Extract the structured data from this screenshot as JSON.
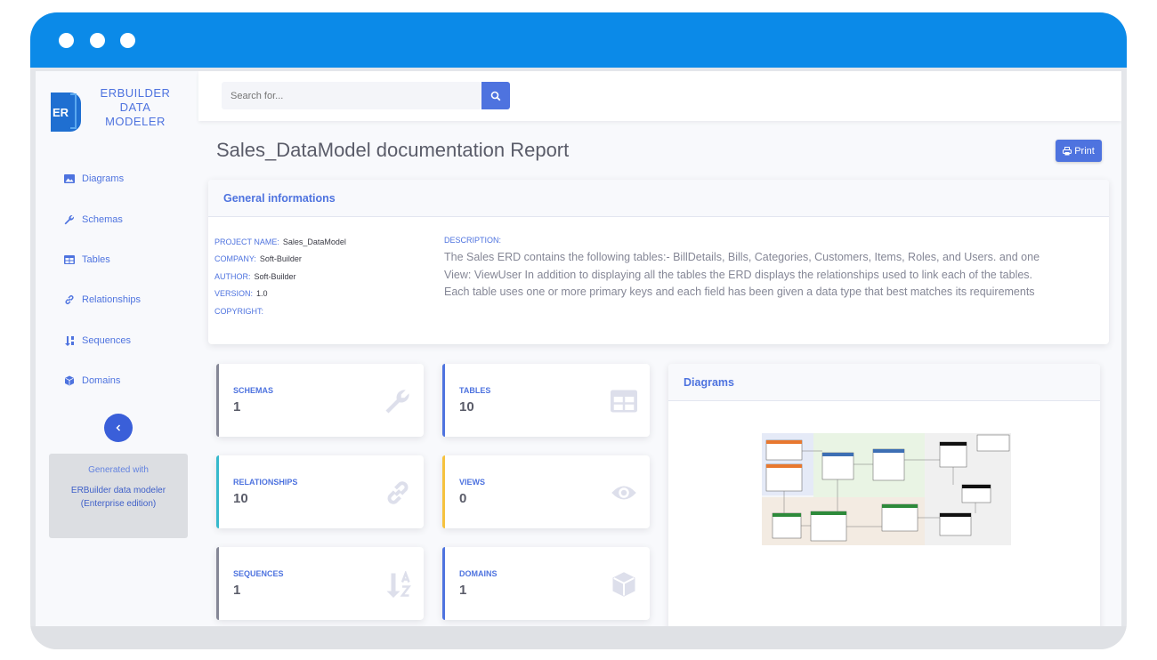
{
  "sidebar": {
    "logo_text": "ERBUILDER DATA MODELER",
    "logo_letters": "ER",
    "items": [
      {
        "label": "Diagrams",
        "icon": "image-icon"
      },
      {
        "label": "Schemas",
        "icon": "wrench-icon"
      },
      {
        "label": "Tables",
        "icon": "table-icon"
      },
      {
        "label": "Relationships",
        "icon": "link-icon"
      },
      {
        "label": "Sequences",
        "icon": "sort-icon"
      },
      {
        "label": "Domains",
        "icon": "cube-icon"
      }
    ],
    "generated_with": "Generated with",
    "generated_product": "ERBuilder data modeler (Enterprise edition)"
  },
  "search": {
    "placeholder": "Search for..."
  },
  "page_title": "Sales_DataModel documentation Report",
  "print_label": "Print",
  "general": {
    "title": "General informations",
    "project_label": "PROJECT NAME:",
    "project_value": "Sales_DataModel",
    "company_label": "COMPANY:",
    "company_value": "Soft-Builder",
    "author_label": "AUTHOR:",
    "author_value": "Soft-Builder",
    "version_label": "VERSION:",
    "version_value": "1.0",
    "copyright_label": "COPYRIGHT:",
    "description_label": "DESCRIPTION:",
    "description": "The Sales ERD contains the following tables:- BillDetails, Bills, Categories, Customers, Items, Roles, and Users. and one View: ViewUser In addition to displaying all the tables the ERD displays the relationships used to link each of the tables. Each table uses one or more primary keys and each field has been given a data type that best matches its requirements"
  },
  "stats": [
    {
      "label": "SCHEMAS",
      "value": "1",
      "color": "#858796",
      "icon": "wrench-icon"
    },
    {
      "label": "TABLES",
      "value": "10",
      "color": "#4e73df",
      "icon": "table-icon"
    },
    {
      "label": "RELATIONSHIPS",
      "value": "10",
      "color": "#36b9cc",
      "icon": "link-icon"
    },
    {
      "label": "VIEWS",
      "value": "0",
      "color": "#f6c23e",
      "icon": "eye-icon"
    },
    {
      "label": "SEQUENCES",
      "value": "1",
      "color": "#858796",
      "icon": "sort-alpha-icon"
    },
    {
      "label": "DOMAINS",
      "value": "1",
      "color": "#4e73df",
      "icon": "cube-icon"
    }
  ],
  "diagrams": {
    "title": "Diagrams"
  },
  "colors": {
    "primary": "#4e73df",
    "titlebar": "#0b8ae8"
  }
}
